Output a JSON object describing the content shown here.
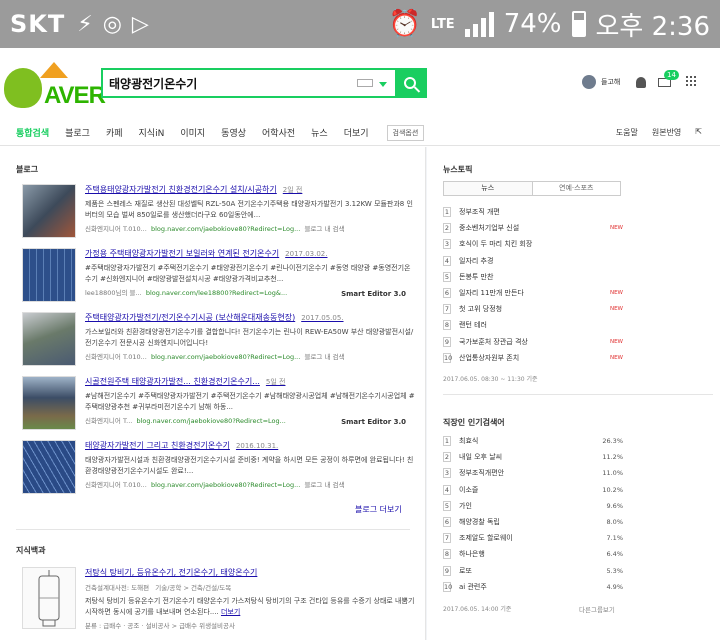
{
  "statusbar": {
    "carrier": "SKT",
    "network": "LTE",
    "battery": "74%",
    "time": "오후 2:36"
  },
  "header": {
    "logo_text": "AVER",
    "search_value": "태양광전기온수기",
    "user_name": "들고해",
    "mail_badge": "14"
  },
  "nav": {
    "tabs": [
      "통합검색",
      "블로그",
      "카페",
      "지식iN",
      "이미지",
      "동영상",
      "어학사전",
      "뉴스",
      "더보기"
    ],
    "option": "검색옵션",
    "right": [
      "도움말",
      "원본반영"
    ]
  },
  "blog": {
    "section_title": "블로그",
    "items": [
      {
        "title": "주택용태양광자가발전기 친환경전기온수기 설치/시공하기",
        "date": "2일 전",
        "desc": "제품은 스펜레스 재질로 생산된 대성쎌틱 RZL-50A 전기온수기주택용 태양광자가발전기 3.12KW 모듈판과8 인버터의 모습 벌써 850일로를 생산했더라구요 60일동안에...",
        "source": "신화엔지니어 T.010...",
        "url": "blog.naver.com/jaebokiove80?Redirect=Log...",
        "action": "블로그 내 검색"
      },
      {
        "title": "가정용 주택태양광자가발전기 보일러와 연계된 전기온수기",
        "date": "2017.03.02.",
        "desc": "#주택태양광자가발전기 #주택전기온수기 #태양광전기온수기 #린나이전기온수기 #동영 태양광 #동영전기온수기 #신화엔지니어 #태양광발전설치시공 #태양광가격비교추천...",
        "source": "lee18800님의 블...",
        "url": "blog.naver.com/lee18800?Redirect=Log&...",
        "editor": "Smart Editor 3.0"
      },
      {
        "title": "주택태양광자가발전기/전기온수기시공 (보산해운대재송동현장)",
        "date": "2017.05.05.",
        "desc": "가스보일러와 친환경태양광전기온수기를 결합합니다! 전기온수기는 린나이 REW-EA50W 부산 태양광발전시설/전기온수기 전문시공 신화엔지니어입니다!",
        "source": "신화엔지니어 T.010...",
        "url": "blog.naver.com/jaebokiove80?Redirect=Log...",
        "action": "블로그 내 검색"
      },
      {
        "title": "시골전원주택 태양광자가발전... 친환경전기온수기...",
        "date": "5일 전",
        "desc": "#남해전기온수기 #주택태양광자가발전기 #주택전기온수기 #남해태양광시공업체 #남해전기온수기시공업체 #주택태양광추천 #귀부라미전기온수기 남해 하동...",
        "source": "신화엔지니어 T...",
        "url": "blog.naver.com/jaebokiove80?Redirect=Log...",
        "editor": "Smart Editor 3.0"
      },
      {
        "title": "태양광자가발전기 그리고 친환경전기온수기",
        "date": "2016.10.31.",
        "desc": "태양광자가발전시설과 친환경태양광전기온수기시설 준비중! 계약을 하시면 모든 공정이 하루면에 완료됩니다! 친환경태양광전기온수기시설도 완료!...",
        "source": "신화엔지니어 T.010...",
        "url": "blog.naver.com/jaebokiove80?Redirect=Log...",
        "action": "블로그 내 검색"
      }
    ],
    "more": "블로그 더보기"
  },
  "encyclopedia": {
    "section_title": "지식백과",
    "title": "저탕식 탕비기, 등유온수기, 전기온수기, 태양온수기",
    "source": "건축설계대사전: 도해편",
    "category": "기술/공학 > 건축/건설/도목",
    "desc": "저탕식 탕비기 등유온수기 전기온수기 태양온수기 가스저탕식 탕비기의 구조 건타입 등유를 수증기 상태로 내뿜기 시작하면 동시에 공기를 내보내며 연소된다....",
    "desc_more": "더보기",
    "meta": "분류 : 급배수 · 공조 · 설비공사 > 급배수 위생설비공사"
  },
  "news_topic": {
    "title": "뉴스토픽",
    "tabs": [
      "뉴스",
      "연예·스포츠"
    ],
    "items": [
      {
        "rank": "1",
        "text": "정부조직 개편",
        "tag": ""
      },
      {
        "rank": "2",
        "text": "중소벤처기업부 신설",
        "tag": "NEW"
      },
      {
        "rank": "3",
        "text": "호식이 두 마리 치킨 회장",
        "tag": ""
      },
      {
        "rank": "4",
        "text": "일자리 추경",
        "tag": ""
      },
      {
        "rank": "5",
        "text": "돈봉투 만찬",
        "tag": ""
      },
      {
        "rank": "6",
        "text": "일자리 11만개 만든다",
        "tag": "NEW"
      },
      {
        "rank": "7",
        "text": "첫 고위 당정청",
        "tag": "NEW"
      },
      {
        "rank": "8",
        "text": "랜턴 테러",
        "tag": ""
      },
      {
        "rank": "9",
        "text": "국가보훈처 장관급 격상",
        "tag": "NEW"
      },
      {
        "rank": "10",
        "text": "산업통상자원부 존치",
        "tag": "NEW"
      }
    ],
    "footer": "2017.06.05. 08:30 ~ 11:30 기준"
  },
  "popular": {
    "title": "직장인 인기검색어",
    "items": [
      {
        "rank": "1",
        "text": "최효식",
        "pct": "26.3%"
      },
      {
        "rank": "2",
        "text": "내일 오후 날씨",
        "pct": "11.2%"
      },
      {
        "rank": "3",
        "text": "정부조직개편안",
        "pct": "11.0%"
      },
      {
        "rank": "4",
        "text": "이소즐",
        "pct": "10.2%"
      },
      {
        "rank": "5",
        "text": "가인",
        "pct": "9.6%"
      },
      {
        "rank": "6",
        "text": "해양경찰 독립",
        "pct": "8.0%"
      },
      {
        "rank": "7",
        "text": "조제알도 할로웨이",
        "pct": "7.1%"
      },
      {
        "rank": "8",
        "text": "하나은행",
        "pct": "6.4%"
      },
      {
        "rank": "9",
        "text": "로또",
        "pct": "5.3%"
      },
      {
        "rank": "10",
        "text": "ai 관련주",
        "pct": "4.9%"
      }
    ],
    "footer": "2017.06.05. 14:00 기준",
    "more": "다른그룹보기"
  },
  "colors": {
    "accent": "#19ce60",
    "link": "#1a0dab",
    "url": "#2a8a2a",
    "new": "#e03030"
  }
}
